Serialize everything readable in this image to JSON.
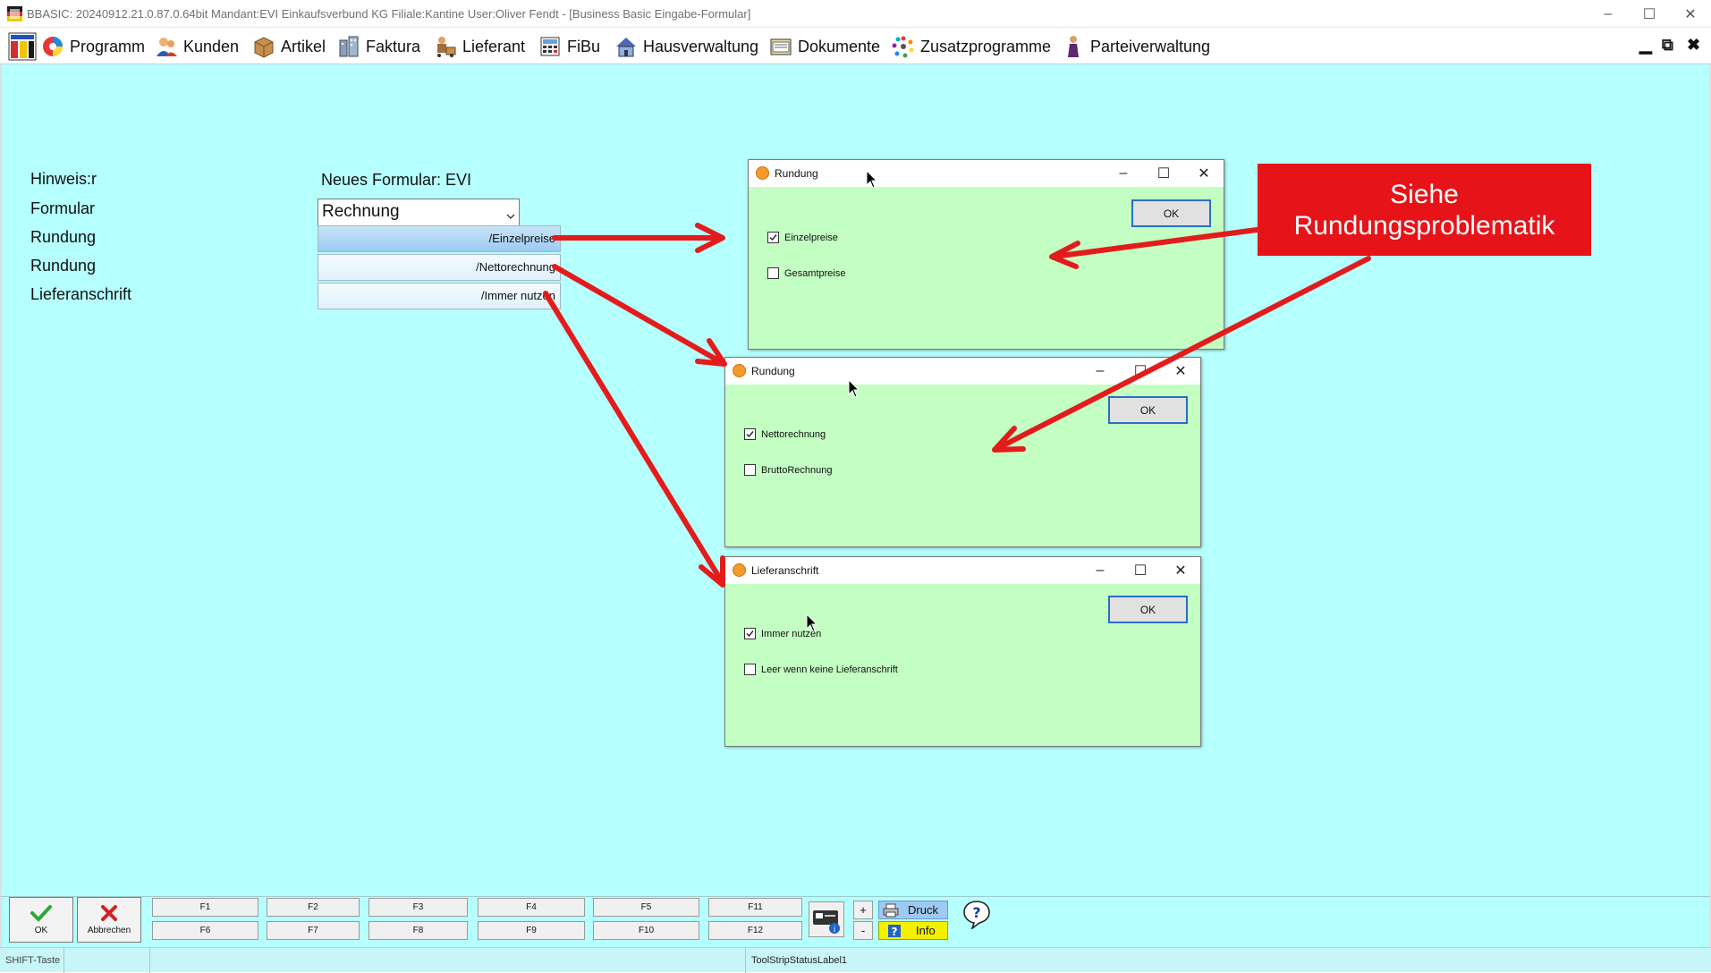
{
  "window": {
    "title": "BBASIC: 20240912.21.0.87.0.64bit Mandant:EVI Einkaufsverbund KG Filiale:Kantine User:Oliver Fendt - [Business Basic Eingabe-Formular]",
    "minimize_glyph": "–",
    "maximize_glyph": "☐",
    "close_glyph": "✕"
  },
  "menubar": {
    "items": [
      {
        "label": "Programm",
        "icon": "programm-icon"
      },
      {
        "label": "Kunden",
        "icon": "kunden-icon"
      },
      {
        "label": "Artikel",
        "icon": "artikel-icon"
      },
      {
        "label": "Faktura",
        "icon": "faktura-icon"
      },
      {
        "label": "Lieferant",
        "icon": "lieferant-icon"
      },
      {
        "label": "FiBu",
        "icon": "fibu-icon"
      },
      {
        "label": "Hausverwaltung",
        "icon": "hausverwaltung-icon"
      },
      {
        "label": "Dokumente",
        "icon": "dokumente-icon"
      },
      {
        "label": "Zusatzprogramme",
        "icon": "zusatzprogramme-icon"
      },
      {
        "label": "Parteiverwaltung",
        "icon": "parteiverwaltung-icon"
      }
    ],
    "mdi_min": "▁",
    "mdi_restore": "⧉",
    "mdi_close": "✖"
  },
  "form": {
    "labels": [
      "Hinweis:r",
      "Formular",
      "Rundung",
      "Rundung",
      "Lieferanschrift"
    ],
    "heading": "Neues Formular: EVI",
    "formular_value": "Rechnung",
    "buttons": [
      "/Einzelpreise",
      "/Nettorechnung",
      "/Immer nutzen"
    ]
  },
  "dialogs": {
    "rundung1": {
      "title": "Rundung",
      "ok": "OK",
      "options": [
        {
          "label": "Einzelpreise",
          "checked": true
        },
        {
          "label": "Gesamtpreise",
          "checked": false
        }
      ]
    },
    "rundung2": {
      "title": "Rundung",
      "ok": "OK",
      "options": [
        {
          "label": "Nettorechnung",
          "checked": true
        },
        {
          "label": "BruttoRechnung",
          "checked": false
        }
      ]
    },
    "lieferanschrift": {
      "title": "Lieferanschrift",
      "ok": "OK",
      "options": [
        {
          "label": "Immer nutzen",
          "checked": true
        },
        {
          "label": "Leer wenn keine Lieferanschrift",
          "checked": false
        }
      ]
    }
  },
  "callout": {
    "line1": "Siehe",
    "line2": "Rundungsproblematik"
  },
  "toolbar": {
    "ok_label": "OK",
    "cancel_label": "Abbrechen",
    "fkeys_top": [
      "F1",
      "F2",
      "F3",
      "F4",
      "F5",
      "F11"
    ],
    "fkeys_bottom": [
      "F6",
      "F7",
      "F8",
      "F9",
      "F10",
      "F12"
    ],
    "plus": "+",
    "minus": "-",
    "druck": "Druck",
    "info": "Info",
    "help_glyph": "?"
  },
  "statusbar": {
    "shift": "SHIFT-Taste",
    "label": "ToolStripStatusLabel1"
  },
  "colors": {
    "main_bg": "#b5ffff",
    "dialog_bg": "#c3ffc3",
    "callout_bg": "#e61419",
    "arrow": "#e31b1b"
  }
}
